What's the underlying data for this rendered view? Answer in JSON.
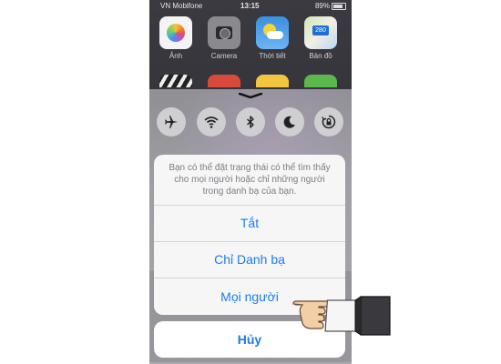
{
  "status_bar": {
    "carrier": "VN Mobifone",
    "time": "13:15",
    "battery": "89%"
  },
  "home_apps": [
    {
      "label": "Ảnh",
      "icon": "photos-icon"
    },
    {
      "label": "Camera",
      "icon": "camera-icon"
    },
    {
      "label": "Thời tiết",
      "icon": "weather-icon"
    },
    {
      "label": "Bản đồ",
      "icon": "maps-icon"
    }
  ],
  "control_center": {
    "toggles": [
      "airplane-mode-icon",
      "wifi-icon",
      "bluetooth-icon",
      "do-not-disturb-moon-icon",
      "rotation-lock-icon"
    ]
  },
  "action_sheet": {
    "message": "Bạn có thể đặt trạng thái có thể tìm thấy cho mọi người hoặc chỉ những người trong danh bạ của bạn.",
    "options": [
      "Tắt",
      "Chỉ Danh bạ",
      "Mọi người"
    ],
    "cancel": "Hủy"
  },
  "colors": {
    "accent": "#1b7cf0"
  }
}
